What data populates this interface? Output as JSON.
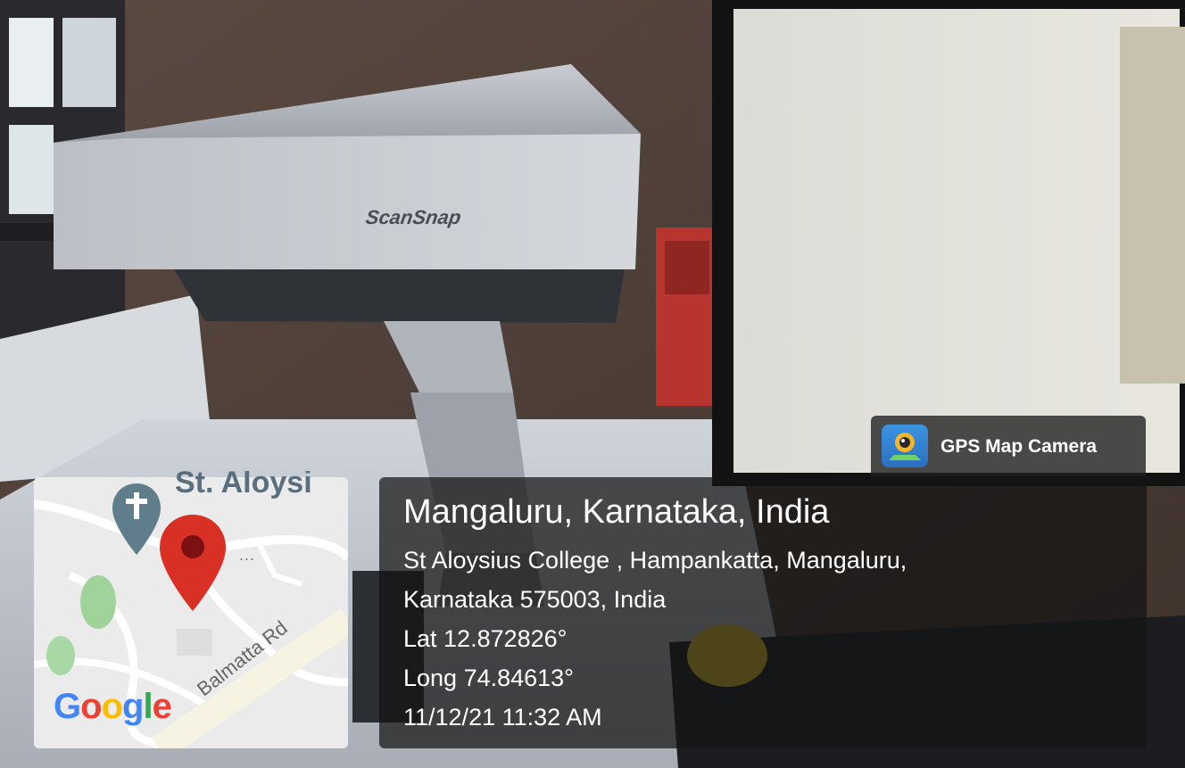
{
  "badge": {
    "label": "GPS Map Camera",
    "icon": "gps-camera-app-icon",
    "color": "#2b6fc0"
  },
  "scanner": {
    "brand": "ScanSnap"
  },
  "map": {
    "place_label": "St. Aloysi",
    "road_label": "Balmatta Rd",
    "brand_letters": [
      "G",
      "o",
      "o",
      "g",
      "l",
      "e"
    ],
    "pin_icon": "map-pin-icon",
    "church_icon": "church-marker-icon",
    "more": "..."
  },
  "location": {
    "title": "Mangaluru, Karnataka, India",
    "address_line1": "St Aloysius College , Hampankatta, Mangaluru,",
    "address_line2": "Karnataka 575003, India",
    "lat": "Lat 12.872826°",
    "long": "Long 74.84613°",
    "datetime": "11/12/21 11:32 AM"
  },
  "colors": {
    "pin": "#d93025",
    "panel": "#141414"
  }
}
